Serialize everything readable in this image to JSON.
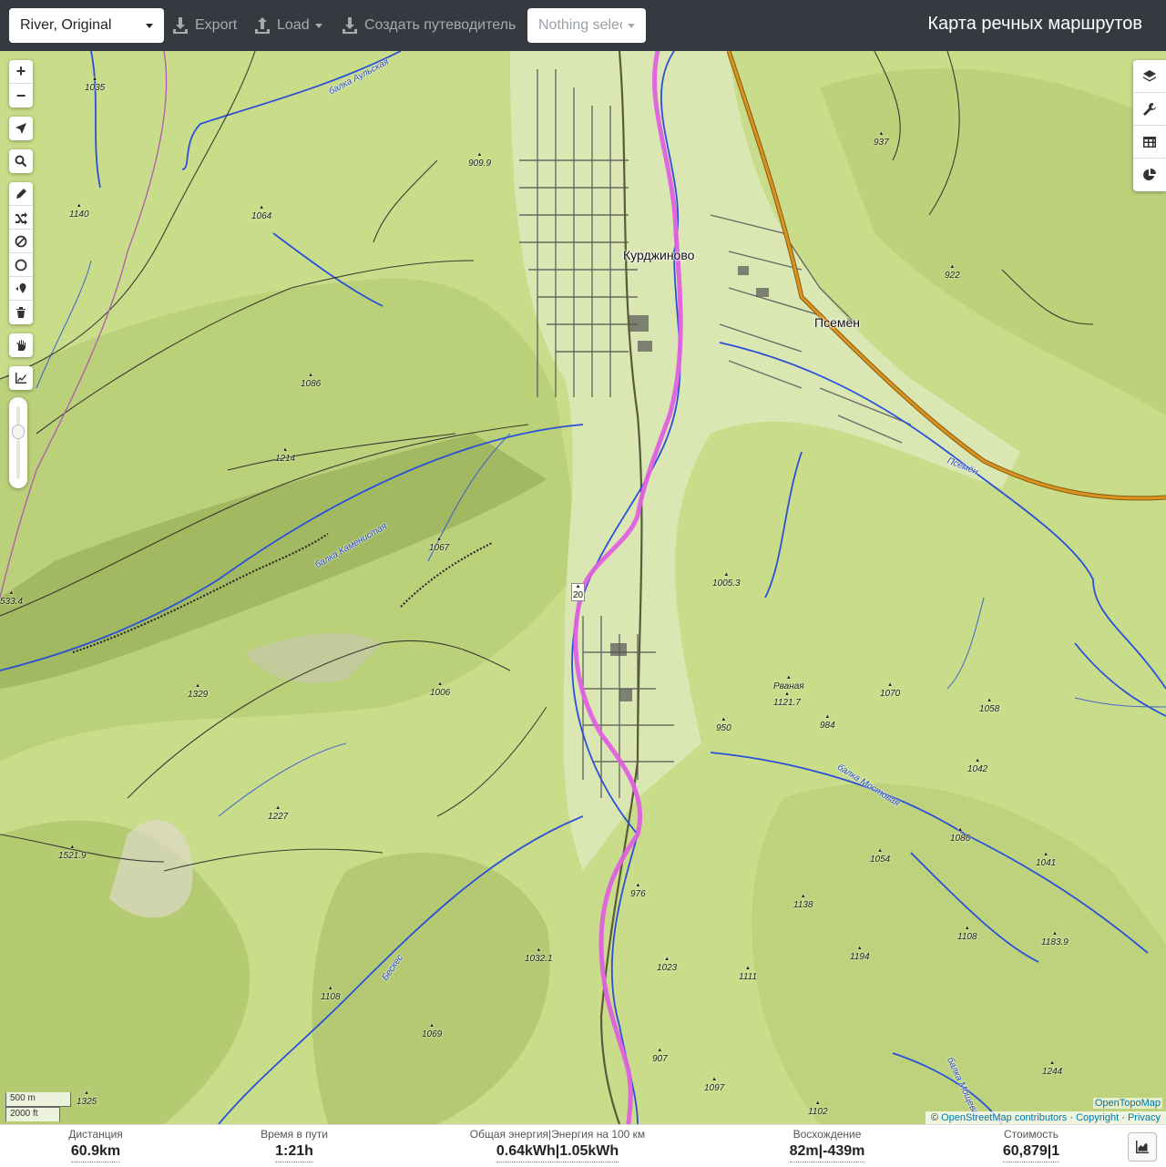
{
  "header": {
    "profile_select": "River, Original",
    "export_label": "Export",
    "load_label": "Load",
    "guide_label": "Создать путеводитель",
    "selection_placeholder": "Nothing selected",
    "app_title": "Карта речных маршрутов"
  },
  "map": {
    "zoom_in": "+",
    "zoom_out": "−",
    "places": [
      "Курджиново",
      "Псемён"
    ],
    "peaks": [
      "1035",
      "909.9",
      "1140",
      "1064",
      "937",
      "922",
      "1086",
      "1214",
      "1067",
      "1005.3",
      "Рваная",
      "1121.7",
      "1070",
      "1058",
      "1329",
      "1006",
      "950",
      "984",
      "1042",
      "1227",
      "1521.9",
      "1086",
      "1054",
      "1041",
      "976",
      "1138",
      "1108",
      "1194",
      "1183.9",
      "1032.1",
      "1023",
      "1111",
      "1108",
      "1069",
      "907",
      "1244",
      "1097",
      "1102",
      "1325",
      "533.4"
    ],
    "water_labels": [
      "балка Аульская",
      "балка Каменистая",
      "балка Мостовая",
      "Псемён",
      "Бескес",
      "балка Мощевая"
    ],
    "road_label": "20",
    "scale_metric": "500 m",
    "scale_imperial": "2000 ft",
    "tile_credit": "OpenTopoMap",
    "attribution_prefix": "© ",
    "attribution_osm": "OpenStreetMap contributors",
    "attribution_sep1": " · ",
    "attribution_copyright": "Copyright",
    "attribution_sep2": " · ",
    "attribution_privacy": "Privacy",
    "colors": {
      "route": "#e060e0",
      "river": "#2b50d8",
      "road_major": "#c87d1a",
      "land": "#c9dc8a"
    }
  },
  "stats": {
    "distance": {
      "label": "Дистанция",
      "value": "60.9km"
    },
    "duration": {
      "label": "Время в пути",
      "value": "1:21h"
    },
    "energy": {
      "label": "Общая энергия|Энергия на 100 км",
      "value": "0.64kWh|1.05kWh"
    },
    "ascent": {
      "label": "Восхождение",
      "value": "82m|-439m"
    },
    "cost": {
      "label": "Стоимость",
      "value": "60,879|1"
    }
  }
}
